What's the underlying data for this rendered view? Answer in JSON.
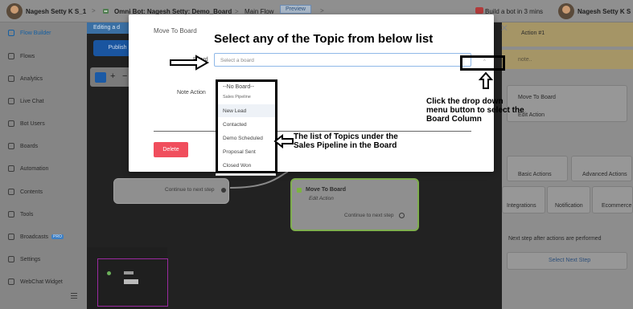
{
  "topbar": {
    "breadcrumb_user": "Nagesh Setty K S_1",
    "separator": ">",
    "bot_name": "Omni Bot: Nagesh Setty: Demo_Board",
    "flow_name": "Main Flow",
    "preview_label": "Preview",
    "promo_text": "Build a bot in 3 mins",
    "user_name": "Nagesh Setty K S"
  },
  "sidebar": {
    "items": [
      {
        "label": "Flow Builder",
        "icon": "flow-builder-icon"
      },
      {
        "label": "Flows",
        "icon": "flows-icon"
      },
      {
        "label": "Analytics",
        "icon": "analytics-icon"
      },
      {
        "label": "Live Chat",
        "icon": "live-chat-icon"
      },
      {
        "label": "Bot Users",
        "icon": "bot-users-icon"
      },
      {
        "label": "Boards",
        "icon": "boards-icon"
      },
      {
        "label": "Automation",
        "icon": "automation-icon"
      },
      {
        "label": "Contents",
        "icon": "contents-icon"
      },
      {
        "label": "Tools",
        "icon": "tools-icon"
      },
      {
        "label": "Broadcasts",
        "icon": "broadcasts-icon",
        "badge": "PRO"
      },
      {
        "label": "Settings",
        "icon": "settings-icon"
      },
      {
        "label": "WebChat Widget",
        "icon": "webchat-widget-icon"
      }
    ],
    "collapse_icon": "menu-icon"
  },
  "canvas": {
    "editing_banner": "Editing a d",
    "publish_label": "Publish",
    "zoom_plus": "+",
    "zoom_minus": "−",
    "node_continue": "Continue to next step",
    "action_node": {
      "title": "Move To Board",
      "subtitle": "Edit Action",
      "continue": "Continue to next step"
    }
  },
  "right_panel": {
    "header": "Action #1",
    "note_placeholder": "note..",
    "move_to_board": "Move To Board",
    "edit_action": "Edit Action",
    "tabs": [
      "Basic Actions",
      "Advanced Actions"
    ],
    "row2": [
      "Integrations",
      "Notification",
      "Ecommerce"
    ],
    "next_step_text": "Next step after actions are performed",
    "select_next_step": "Select Next Step"
  },
  "modal": {
    "title": "Move To Board",
    "board_label": "Board",
    "select_placeholder": "Select a board",
    "note_label": "Note Action",
    "delete_label": "Delete",
    "close_icon": "close-icon",
    "dropdown": {
      "items": [
        "--No Board--",
        "Sales Pipeline",
        "New Lead",
        "Contacted",
        "Demo Scheduled",
        "Proposal Sent",
        "Closed Won"
      ]
    }
  },
  "annotations": {
    "heading": "Select any of the Topic from below list",
    "dropdown_hint": "Click the drop down menu button to select the Board Column",
    "list_hint": "The list of Topics under the Sales Pipeline in the Board"
  },
  "colors": {
    "accent": "#1f6fbf",
    "danger": "#f04e5d",
    "node_green": "#7cb342"
  }
}
